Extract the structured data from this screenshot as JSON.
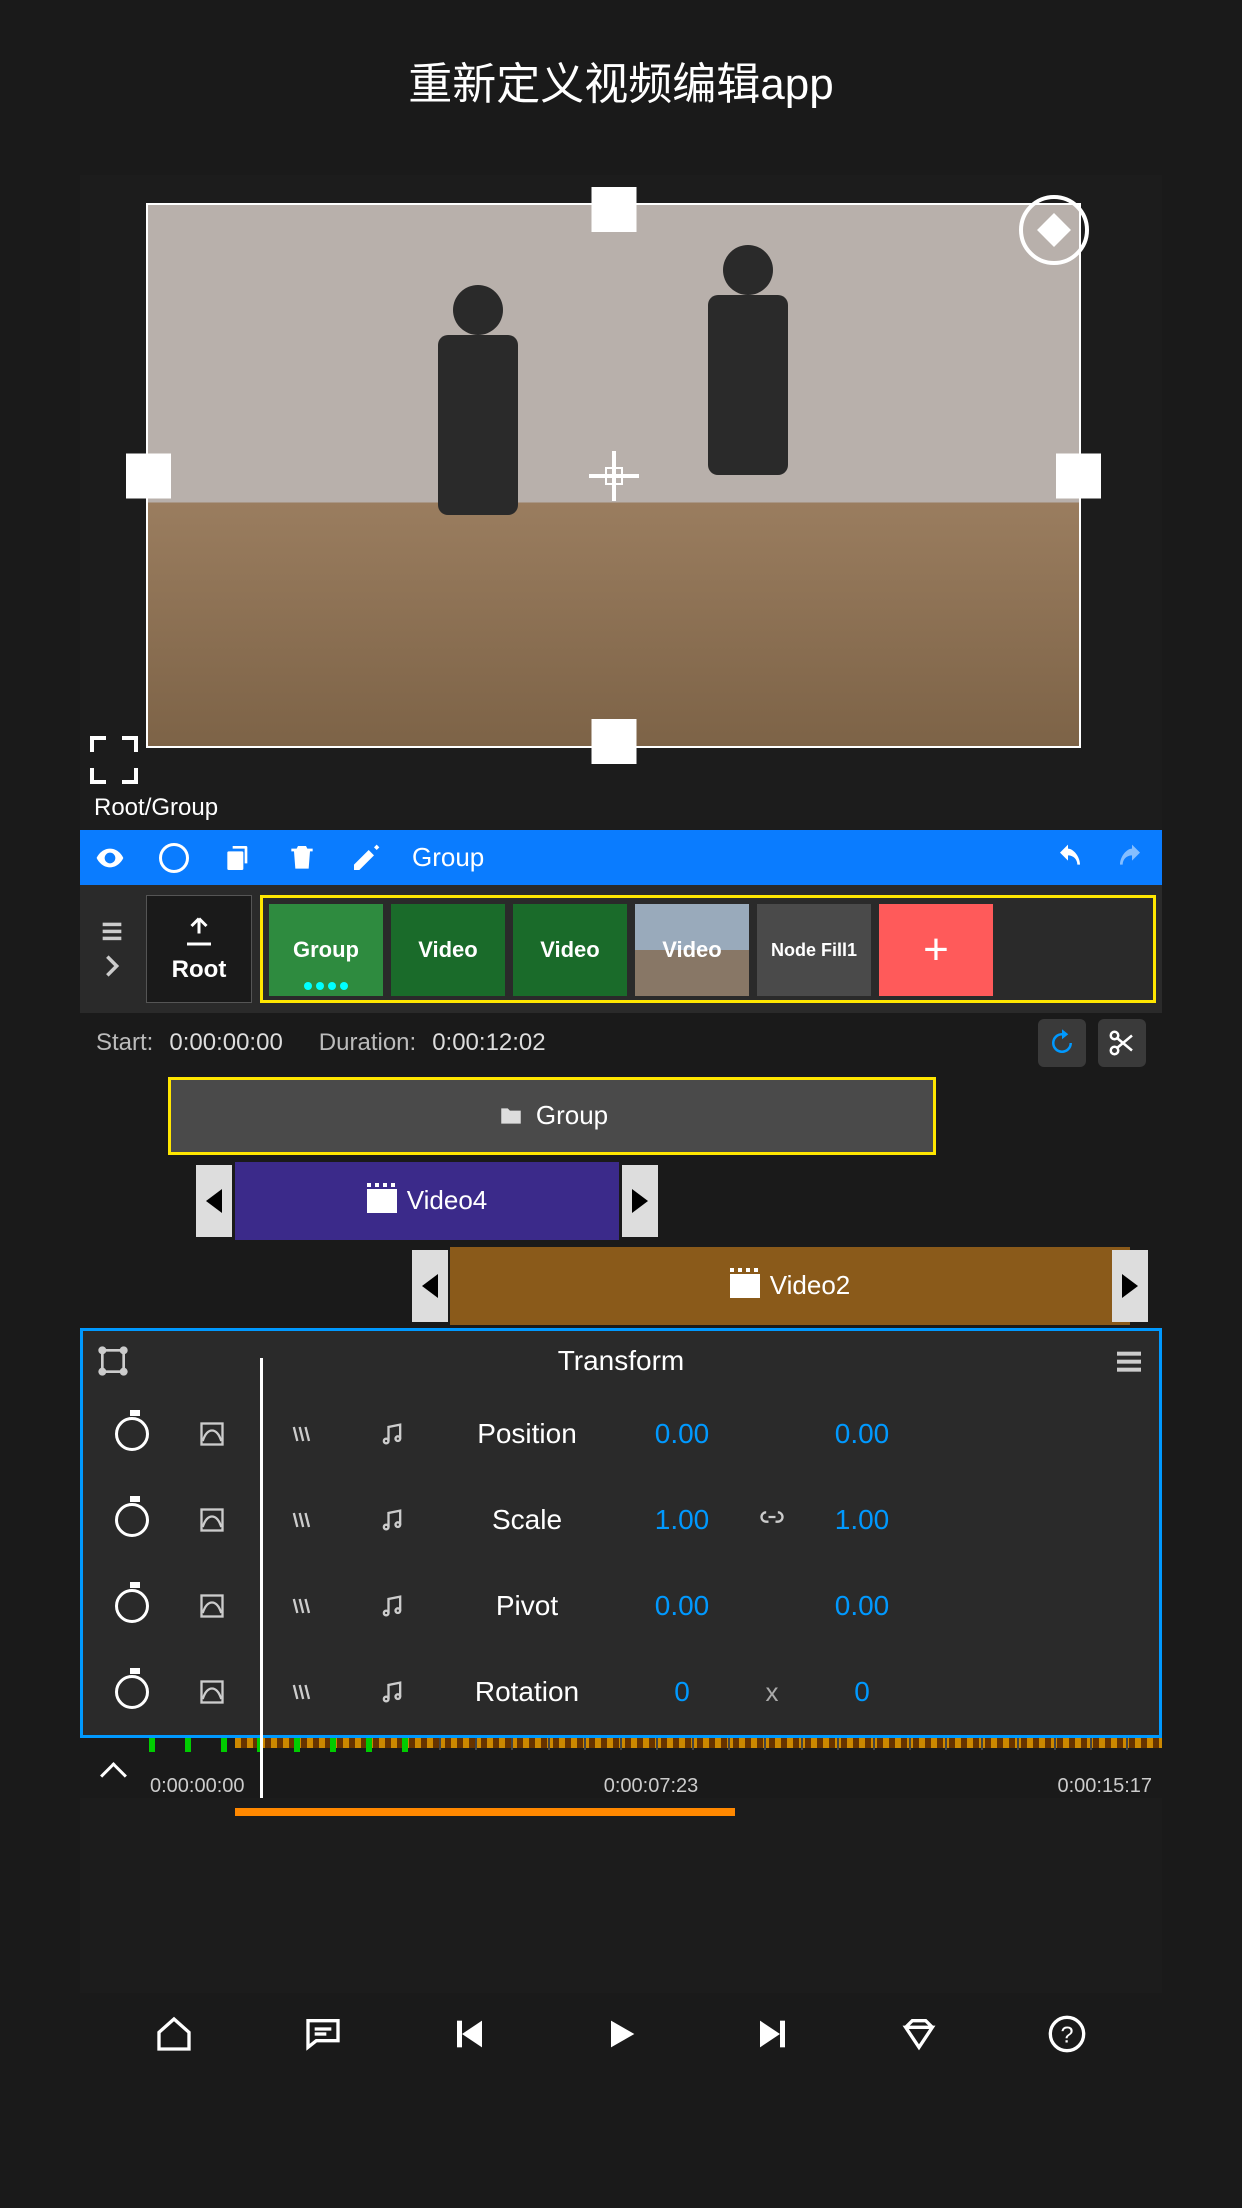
{
  "title": "重新定义视频编辑app",
  "breadcrumb": "Root/Group",
  "toolbar": {
    "group_label": "Group"
  },
  "root_label": "Root",
  "clips": [
    {
      "label": "Group",
      "type": "group"
    },
    {
      "label": "Video",
      "type": "video"
    },
    {
      "label": "Video",
      "type": "video"
    },
    {
      "label": "Video",
      "type": "video"
    },
    {
      "label": "Node Fill1",
      "type": "node"
    }
  ],
  "add_label": "+",
  "timing": {
    "start_label": "Start:",
    "start_value": "0:00:00:00",
    "duration_label": "Duration:",
    "duration_value": "0:00:12:02"
  },
  "tracks": {
    "group": "Group",
    "video4": "Video4",
    "video2": "Video2"
  },
  "transform": {
    "title": "Transform",
    "rows": [
      {
        "name": "Position",
        "a": "0.00",
        "b": "0.00",
        "sep": ""
      },
      {
        "name": "Scale",
        "a": "1.00",
        "b": "1.00",
        "sep": "link"
      },
      {
        "name": "Pivot",
        "a": "0.00",
        "b": "0.00",
        "sep": ""
      },
      {
        "name": "Rotation",
        "a": "0",
        "b": "0",
        "sep": "x"
      }
    ]
  },
  "ruler": {
    "t0": "0:00:00:00",
    "t1": "0:00:07:23",
    "t2": "0:00:15:17"
  }
}
